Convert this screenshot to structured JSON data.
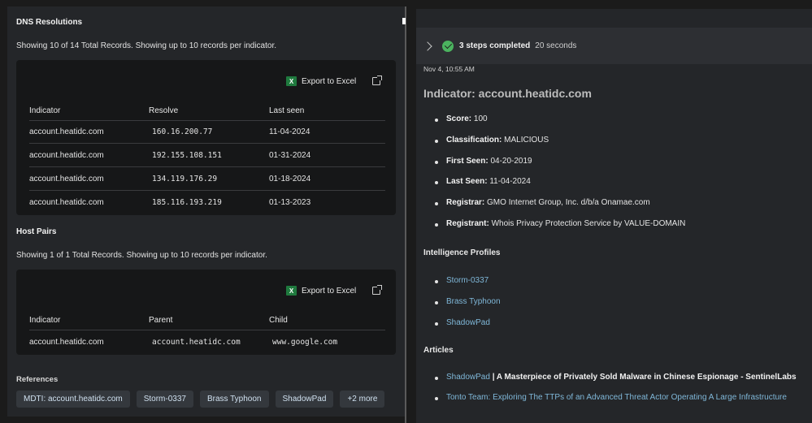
{
  "dns": {
    "title": "DNS Resolutions",
    "summary": "Showing 10 of 14 Total Records. Showing up to 10 records per indicator.",
    "export_label": "Export to Excel",
    "columns": [
      "Indicator",
      "Resolve",
      "Last seen"
    ],
    "rows": [
      [
        "account.heatidc.com",
        "160.16.200.77",
        "11-04-2024"
      ],
      [
        "account.heatidc.com",
        "192.155.108.151",
        "01-31-2024"
      ],
      [
        "account.heatidc.com",
        "134.119.176.29",
        "01-18-2024"
      ],
      [
        "account.heatidc.com",
        "185.116.193.219",
        "01-13-2023"
      ]
    ]
  },
  "host_pairs": {
    "title": "Host Pairs",
    "summary": "Showing 1 of 1 Total Records. Showing up to 10 records per indicator.",
    "export_label": "Export to Excel",
    "columns": [
      "Indicator",
      "Parent",
      "Child"
    ],
    "rows": [
      [
        "account.heatidc.com",
        "account.heatidc.com",
        "www.google.com"
      ]
    ]
  },
  "references": {
    "title": "References",
    "chips": [
      "MDTI: account.heatidc.com",
      "Storm-0337",
      "Brass Typhoon",
      "ShadowPad",
      "+2 more"
    ]
  },
  "steps": {
    "label": "3 steps completed",
    "duration": "20 seconds"
  },
  "response": {
    "timestamp": "Nov 4, 10:55 AM",
    "heading": "Indicator: account.heatidc.com",
    "facts": [
      {
        "key": "Score:",
        "value": "100"
      },
      {
        "key": "Classification:",
        "value": "MALICIOUS"
      },
      {
        "key": "First Seen:",
        "value": "04-20-2019"
      },
      {
        "key": "Last Seen:",
        "value": "11-04-2024"
      },
      {
        "key": "Registrar:",
        "value": "GMO Internet Group, Inc. d/b/a Onamae.com"
      },
      {
        "key": "Registrant:",
        "value": "Whois Privacy Protection Service by VALUE-DOMAIN"
      }
    ],
    "profiles_title": "Intelligence Profiles",
    "profiles": [
      "Storm-0337",
      "Brass Typhoon",
      "ShadowPad"
    ],
    "articles_title": "Articles",
    "articles": [
      {
        "link": "ShadowPad",
        "rest": " | A Masterpiece of Privately Sold Malware in Chinese Espionage - SentinelLabs"
      },
      {
        "link": "Tonto Team: Exploring The TTPs of an Advanced Threat Actor Operating A Large Infrastructure",
        "rest": ""
      }
    ]
  },
  "icons": {
    "excel": "excel-icon",
    "external": "external-link-icon",
    "check": "check-circle-icon",
    "chevron": "chevron-right-icon"
  },
  "colors": {
    "link": "#7fb7d8",
    "success": "#4bb35f",
    "chip_bg": "#34383d"
  }
}
